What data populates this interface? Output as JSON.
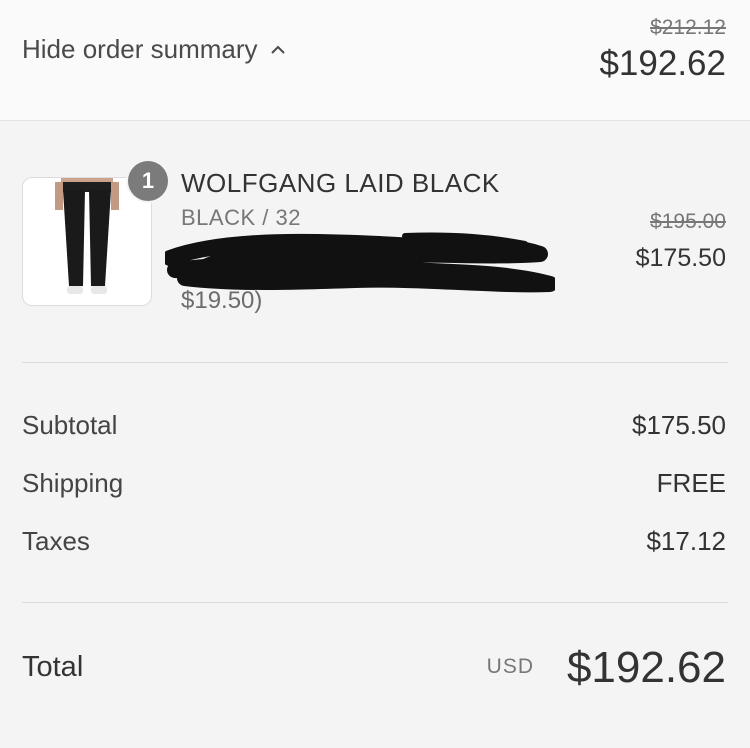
{
  "header": {
    "toggle_label": "Hide order summary",
    "toggle_icon": "chevron-up-icon",
    "original_total": "$212.12",
    "total": "$192.62"
  },
  "item": {
    "quantity": "1",
    "name": "WOLFGANG LAID BLACK",
    "variant": "BLACK / 32",
    "discount_fragment": "$19.50)",
    "original_price": "$195.00",
    "price": "$175.50"
  },
  "summary": {
    "rows": [
      {
        "label": "Subtotal",
        "value": "$175.50"
      },
      {
        "label": "Shipping",
        "value": "FREE"
      },
      {
        "label": "Taxes",
        "value": "$17.12"
      }
    ]
  },
  "total": {
    "label": "Total",
    "currency": "USD",
    "amount": "$192.62"
  },
  "colors": {
    "background": "#f4f4f4",
    "header_background": "#fafafa",
    "badge": "#7b7b7b",
    "text": "#333333",
    "muted": "#777777"
  }
}
